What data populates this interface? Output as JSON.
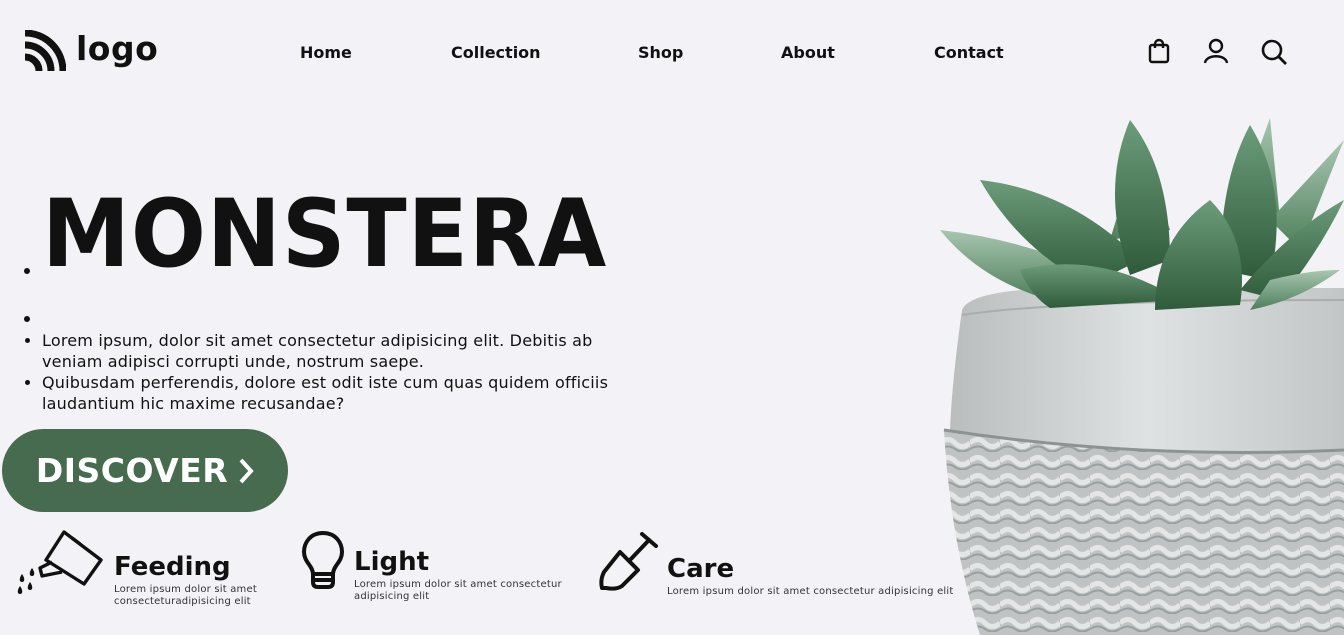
{
  "header": {
    "logo_text": "logo",
    "nav": [
      "Home",
      "Collection",
      "Shop",
      "About",
      "Contact"
    ],
    "icons": [
      "shopping-bag-icon",
      "user-icon",
      "search-icon"
    ]
  },
  "hero": {
    "title": "MONSTERA",
    "paragraphs": [
      "Lorem ipsum, dolor sit amet consectetur adipisicing elit. Debitis ab veniam adipisci corrupti unde, nostrum saepe.",
      "Quibusdam perferendis, dolore est odit iste cum quas quidem officiis laudantium hic maxime recusandae?"
    ],
    "cta_label": "DISCOVER",
    "cta_color": "#476b4e"
  },
  "features": [
    {
      "icon": "watering-can-icon",
      "title": "Feeding",
      "text": "Lorem ipsum dolor sit amet consecteturadipisicing elit"
    },
    {
      "icon": "light-bulb-icon",
      "title": "Light",
      "text": "Lorem ipsum dolor sit amet consectetur adipisicing elit"
    },
    {
      "icon": "shovel-icon",
      "title": "Care",
      "text": "Lorem ipsum dolor sit amet consectetur adipisicing elit"
    }
  ],
  "image": {
    "subject": "succulent-in-concrete-pot"
  },
  "colors": {
    "background": "#f3f2f7",
    "accent": "#476b4e",
    "text": "#111111"
  }
}
